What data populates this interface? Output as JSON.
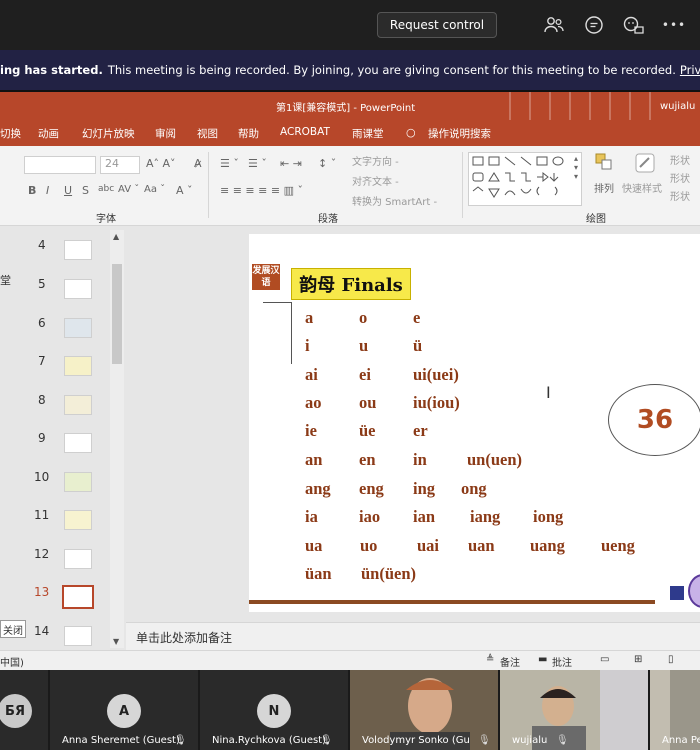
{
  "teams": {
    "request_control": "Request control",
    "notice_bold": "ing has started.",
    "notice_text": "This meeting is being recorded. By joining, you are giving consent for this meeting to be recorded.",
    "privacy_link": "Privacy policy",
    "icons": [
      "people-icon",
      "chat-icon",
      "reactions-icon",
      "more-icon"
    ],
    "more": "•••"
  },
  "ppt": {
    "title": "第1课[兼容模式] - PowerPoint",
    "user": "wujialu",
    "tabs": [
      "切换",
      "动画",
      "幻灯片放映",
      "审阅",
      "视图",
      "帮助",
      "ACROBAT",
      "雨课堂",
      "操作说明搜索"
    ],
    "ribbon": {
      "font_size": "24",
      "font_group": "字体",
      "para_group": "段落",
      "draw_group": "绘图",
      "text_direction": "文字方向 -",
      "align_text": "对齐文本 -",
      "smartart": "转换为 SmartArt -",
      "arrange": "排列",
      "quick_style": "快速样式",
      "shape_fill": "形状",
      "shape_outline": "形状",
      "shape_effect": "形状"
    },
    "side_label": "堂",
    "close_label": "关闭",
    "slides": [
      4,
      5,
      6,
      7,
      8,
      9,
      10,
      11,
      12,
      13,
      14
    ],
    "active_slide": 13,
    "notes_placeholder": "单击此处添加备注",
    "status": {
      "lang": "中国)",
      "notes": "备注",
      "comments": "批注"
    }
  },
  "slide": {
    "logo": "发展汉语",
    "title": "韵母 Finals",
    "rows": [
      [
        "a",
        "o",
        "e"
      ],
      [
        "i",
        "u",
        "ü"
      ],
      [
        "ai",
        "ei",
        "ui(uei)"
      ],
      [
        "ao",
        "ou",
        "iu(iou)"
      ],
      [
        "ie",
        "üe",
        "er"
      ],
      [
        "an",
        "en",
        "in",
        "un(uen)"
      ],
      [
        "ang",
        "eng",
        "ing",
        "ong"
      ],
      [
        "ia",
        "iao",
        "ian",
        "iang",
        "iong"
      ],
      [
        "ua",
        "uo",
        "uai",
        "uan",
        "uang",
        "ueng"
      ],
      [
        "üan",
        "ün(üen)"
      ]
    ],
    "page_number": "36"
  },
  "participants": [
    {
      "initials": "БЯ",
      "name": "",
      "color": "#c9c9c9"
    },
    {
      "initials": "A",
      "name": "Anna Sheremet (Guest)",
      "color": "#d6d6d6"
    },
    {
      "initials": "N",
      "name": "Nina.Rychkova (Guest)",
      "color": "#d6d6d6"
    },
    {
      "initials": "",
      "name": "Volodymyr Sonko (Gu",
      "color": "#7a6a55"
    },
    {
      "initials": "",
      "name": "wujialu",
      "color": "#8a8a80"
    },
    {
      "initials": "",
      "name": "Anna Pe",
      "color": "#6f6f68"
    }
  ]
}
